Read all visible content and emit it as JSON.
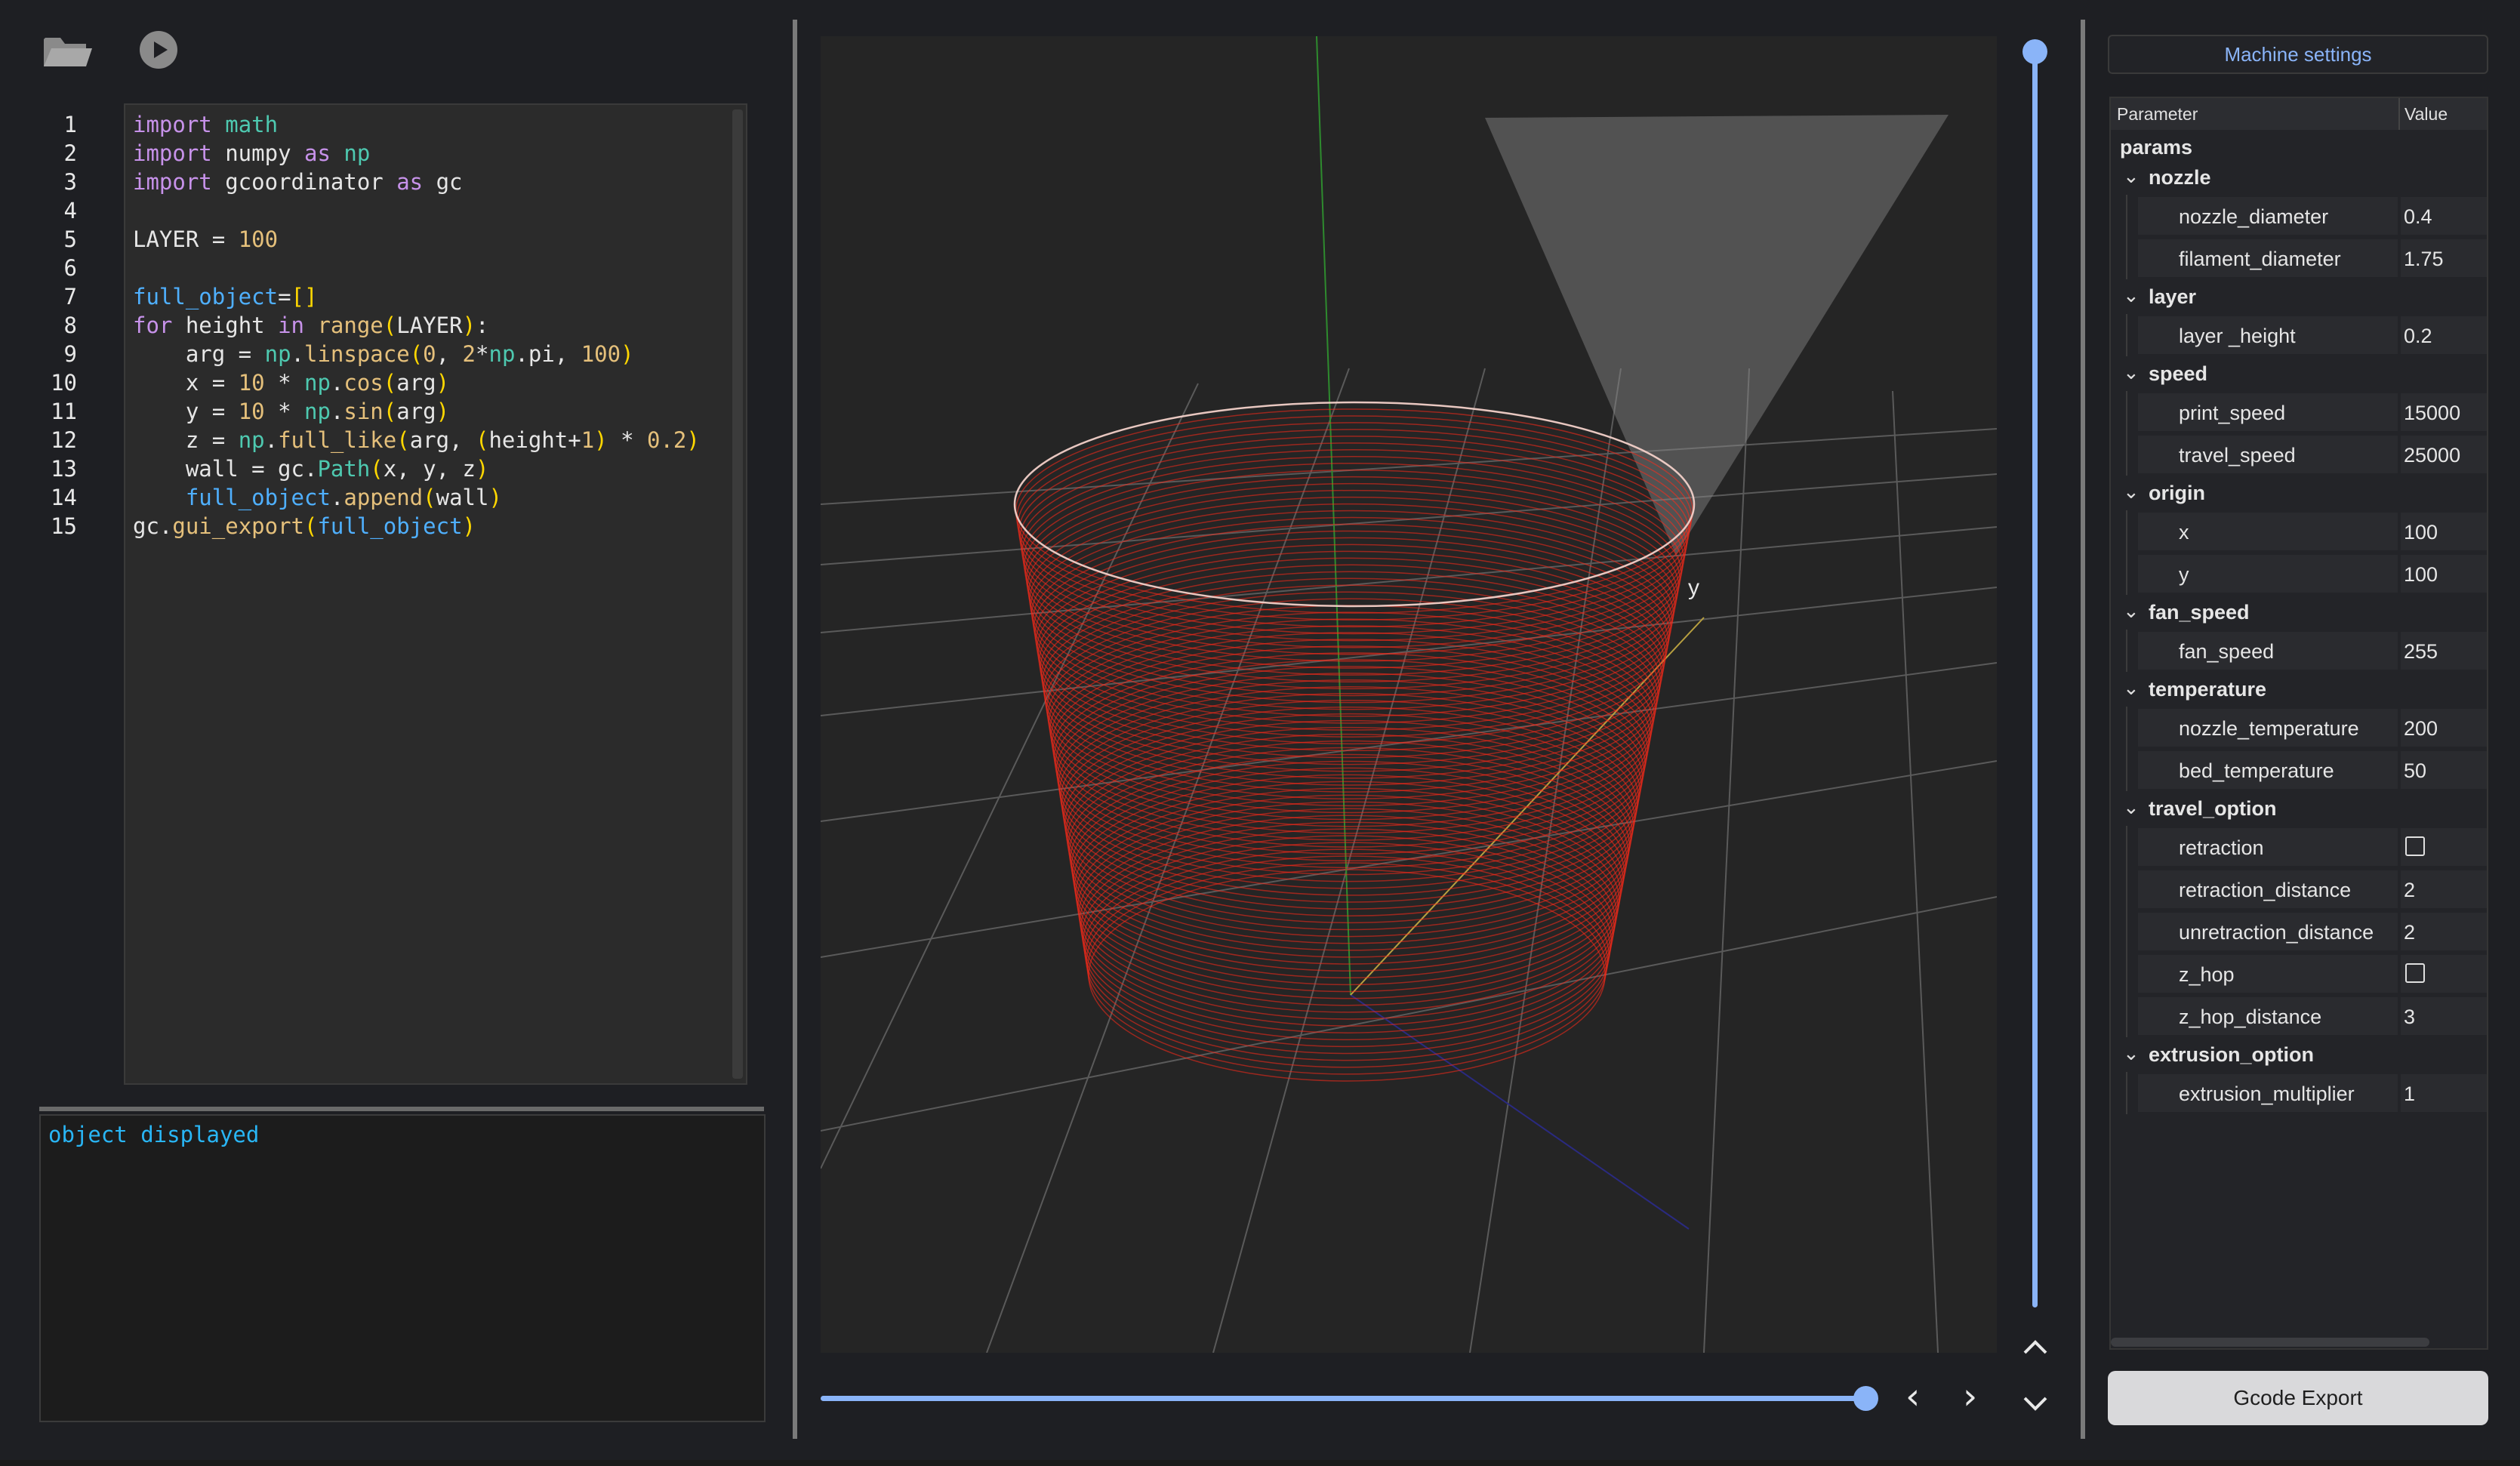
{
  "toolbar": {
    "open_icon": "folder-open-icon",
    "run_icon": "play-icon"
  },
  "editor": {
    "line_numbers": [
      "1",
      "2",
      "3",
      "4",
      "5",
      "6",
      "7",
      "8",
      "9",
      "10",
      "11",
      "12",
      "13",
      "14",
      "15"
    ],
    "lines": [
      "import math",
      "import numpy as np",
      "import gcoordinator as gc",
      "",
      "LAYER = 100",
      "",
      "full_object=[]",
      "for height in range(LAYER):",
      "    arg = np.linspace(0, 2*np.pi, 100)",
      "    x = 10 * np.cos(arg)",
      "    y = 10 * np.sin(arg)",
      "    z = np.full_like(arg, (height+1) * 0.2)",
      "    wall = gc.Path(x, y, z)",
      "    full_object.append(wall)",
      "gc.gui_export(full_object)"
    ]
  },
  "console": {
    "output": "object displayed"
  },
  "viewport": {
    "axis_label_y": "y",
    "layer_slider": {
      "level": 1.0
    },
    "step_slider": {
      "level": 1.0
    },
    "colors": {
      "path": "#ff2a1a",
      "grid": "#5a5a5a",
      "axis_green": "#2e8b2e",
      "axis_yellow": "#b8a040",
      "axis_blue": "#2a2a80"
    }
  },
  "settings": {
    "machine_settings_label": "Machine settings",
    "header": {
      "parameter": "Parameter",
      "value": "Value"
    },
    "root": "params",
    "groups": [
      {
        "name": "nozzle",
        "params": [
          {
            "name": "nozzle_diameter",
            "value": "0.4"
          },
          {
            "name": "filament_diameter",
            "value": "1.75"
          }
        ]
      },
      {
        "name": "layer",
        "params": [
          {
            "name": "layer _height",
            "value": "0.2"
          }
        ]
      },
      {
        "name": "speed",
        "params": [
          {
            "name": "print_speed",
            "value": "15000"
          },
          {
            "name": "travel_speed",
            "value": "25000"
          }
        ]
      },
      {
        "name": "origin",
        "params": [
          {
            "name": "x",
            "value": "100"
          },
          {
            "name": "y",
            "value": "100"
          }
        ]
      },
      {
        "name": "fan_speed",
        "params": [
          {
            "name": "fan_speed",
            "value": "255"
          }
        ]
      },
      {
        "name": "temperature",
        "params": [
          {
            "name": "nozzle_temperature",
            "value": "200"
          },
          {
            "name": "bed_temperature",
            "value": "50"
          }
        ]
      },
      {
        "name": "travel_option",
        "params": [
          {
            "name": "retraction",
            "checkbox": true,
            "checked": false
          },
          {
            "name": "retraction_distance",
            "value": "2"
          },
          {
            "name": "unretraction_distance",
            "value": "2"
          },
          {
            "name": "z_hop",
            "checkbox": true,
            "checked": false
          },
          {
            "name": "z_hop_distance",
            "value": "3"
          }
        ]
      },
      {
        "name": "extrusion_option",
        "params": [
          {
            "name": "extrusion_multiplier",
            "value": "1"
          }
        ]
      }
    ],
    "export_label": "Gcode Export"
  }
}
